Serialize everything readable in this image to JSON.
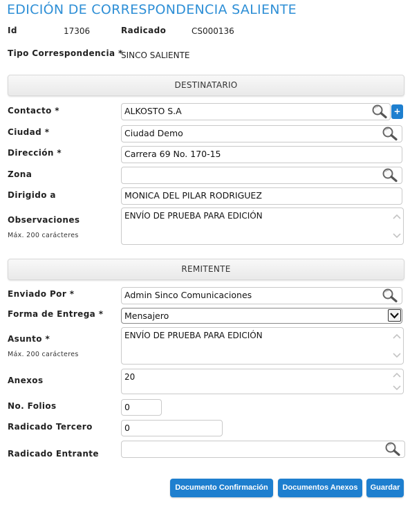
{
  "page": {
    "title": "EDICIÓN DE CORRESPONDENCIA SALIENTE"
  },
  "header_info": {
    "id_label": "Id",
    "id_value": "17306",
    "radicado_label": "Radicado",
    "radicado_value": "CS000136",
    "tipo_label": "Tipo Correspondencia *",
    "tipo_value": "SINCO SALIENTE"
  },
  "destinatario": {
    "section_title": "DESTINATARIO",
    "contacto_label": "Contacto *",
    "contacto_value": "ALKOSTO S.A",
    "add_label": "+",
    "ciudad_label": "Ciudad *",
    "ciudad_value": "Ciudad Demo",
    "direccion_label": "Dirección *",
    "direccion_value": "Carrera 69 No. 170-15",
    "zona_label": "Zona",
    "zona_value": "",
    "dirigido_label": "Dirigido a",
    "dirigido_value": "MONICA DEL PILAR RODRIGUEZ",
    "observaciones_label": "Observaciones",
    "observaciones_hint": "Máx. 200 carácteres",
    "observaciones_value": "ENVÍO DE PRUEBA PARA EDICIÓN"
  },
  "remitente": {
    "section_title": "REMITENTE",
    "enviado_label": "Enviado Por *",
    "enviado_value": "Admin Sinco Comunicaciones",
    "forma_label": "Forma de Entrega *",
    "forma_value": "Mensajero",
    "asunto_label": "Asunto *",
    "asunto_hint": "Máx. 200 carácteres",
    "asunto_value": "ENVÍO DE PRUEBA PARA EDICIÓN",
    "anexos_label": "Anexos",
    "anexos_value": "20",
    "folios_label": "No. Folios",
    "folios_value": "0",
    "radicado_tercero_label": "Radicado Tercero",
    "radicado_tercero_value": "0",
    "radicado_entrante_label": "Radicado Entrante",
    "radicado_entrante_value": ""
  },
  "actions": {
    "confirmacion_label": "Documento Confirmación",
    "anexos_docs_label": "Documentos Anexos",
    "guardar_label": "Guardar"
  },
  "colors": {
    "title": "#2e8fd6",
    "button": "#1e7fcf"
  },
  "icons": {
    "lookup": "search-icon",
    "select": "chevron-down-icon"
  }
}
